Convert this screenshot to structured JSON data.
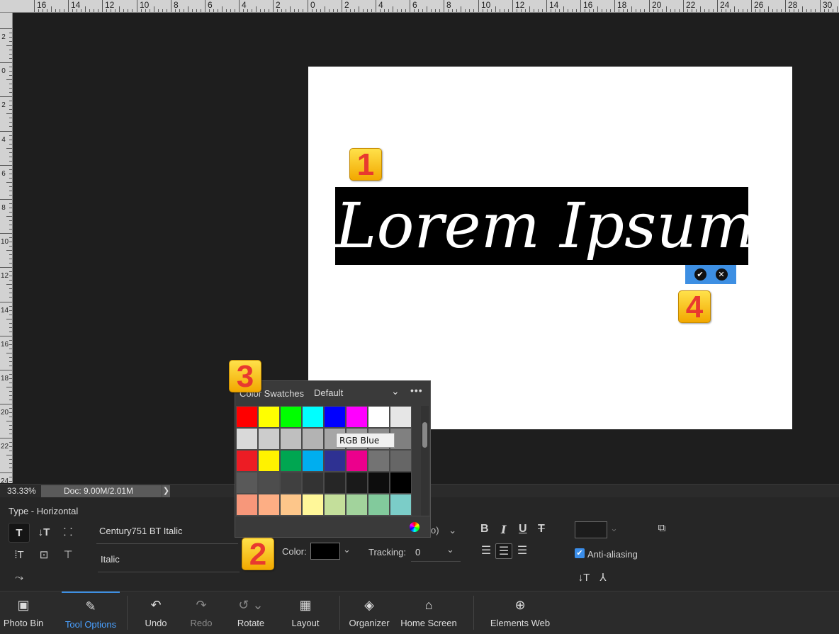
{
  "ruler": {
    "top_labels": [
      "16",
      "14",
      "12",
      "10",
      "8",
      "6",
      "4",
      "2",
      "0",
      "2",
      "4",
      "6",
      "8",
      "10",
      "12",
      "14",
      "16",
      "18",
      "20",
      "22",
      "24",
      "26",
      "28",
      "30"
    ],
    "left_labels": [
      "2",
      "0",
      "2",
      "4",
      "6",
      "8",
      "10",
      "12",
      "14",
      "16",
      "18",
      "20",
      "22",
      "24"
    ]
  },
  "canvas": {
    "text": "Lorem Ipsum",
    "commit_icon": "check-icon",
    "cancel_icon": "cancel-icon"
  },
  "badges": {
    "b1": "1",
    "b2": "2",
    "b3": "3",
    "b4": "4"
  },
  "status": {
    "zoom": "33.33%",
    "doc": "Doc: 9.00M/2.01M",
    "arrow": "❯"
  },
  "tool_options": {
    "title": "Type - Horizontal",
    "font_family": "Century751 BT Italic",
    "font_style": "Italic",
    "size_fragment": "o)",
    "color_label": "Color:",
    "tracking_label": "Tracking:",
    "tracking_value": "0",
    "bold": "B",
    "italic": "I",
    "underline": "U",
    "strike": "T",
    "anti_aliasing": "Anti-aliasing"
  },
  "swatch_panel": {
    "title": "Color Swatches",
    "preset": "Default",
    "tooltip": "RGB Blue",
    "colors": [
      "#ff0000",
      "#ffff00",
      "#00ff00",
      "#00ffff",
      "#0000ff",
      "#ff00ff",
      "#ffffff",
      "#e6e6e6",
      "#d9d9d9",
      "#cccccc",
      "#bfbfbf",
      "#b3b3b3",
      "#a6a6a6",
      "#999999",
      "#8c8c8c",
      "#808080",
      "#ed1c24",
      "#fff200",
      "#00a651",
      "#00aeef",
      "#2e3192",
      "#ec008c",
      "#737373",
      "#666666",
      "#595959",
      "#4d4d4d",
      "#404040",
      "#333333",
      "#262626",
      "#1a1a1a",
      "#0d0d0d",
      "#000000",
      "#f7977a",
      "#fdae84",
      "#fdc68a",
      "#fff799",
      "#c4df9b",
      "#a2d39c",
      "#82ca9c",
      "#7bcdc8"
    ]
  },
  "taskbar": {
    "photo_bin": "Photo Bin",
    "tool_options": "Tool Options",
    "undo": "Undo",
    "redo": "Redo",
    "rotate": "Rotate",
    "layout": "Layout",
    "organizer": "Organizer",
    "home_screen": "Home Screen",
    "elements_web": "Elements Web"
  }
}
